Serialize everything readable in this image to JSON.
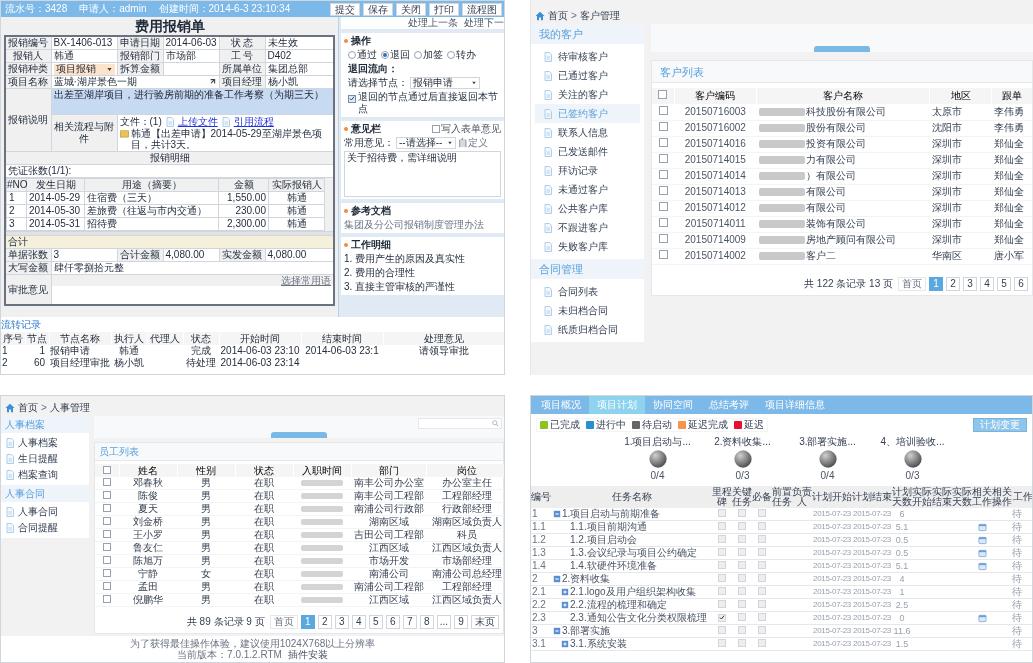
{
  "expense_form": {
    "header": [
      "流水号：3428",
      "申请人：admin",
      "创建时间：2014-6-3 23:10:34"
    ],
    "toolbar": [
      "提交",
      "保存",
      "关闭",
      "打印",
      "流程图"
    ],
    "nav_links": [
      "处理上一条",
      "处理下一"
    ],
    "title": "费用报销单",
    "field_rows": [
      [
        {
          "label": "报销编号",
          "value": "BX-1406-013"
        },
        {
          "label": "申请日期",
          "value": "2014-06-03"
        },
        {
          "label": "状 态",
          "value": "未生效"
        }
      ],
      [
        {
          "label": "报销人",
          "value": "韩通"
        },
        {
          "label": "报销部门",
          "value": "市场部"
        },
        {
          "label": "工 号",
          "value": "D402"
        }
      ],
      [
        {
          "label": "报销种类",
          "value": "项目报销",
          "kind": "select"
        },
        {
          "label": "拆算金额"
        },
        {
          "label": "所属单位",
          "value": "集团总部"
        }
      ],
      [
        {
          "label": "项目名称",
          "value": "蓝城·湖岸景色一期",
          "kind": "lookup"
        },
        {
          "label": "项目经理",
          "value": "杨小凯"
        }
      ]
    ],
    "description": {
      "label": "报销说明",
      "value": "出差至湖岸项目，进行验房前期的准备工作考察（为期三天）"
    },
    "related": {
      "label": "相关流程与附件",
      "files": "文件：(1)",
      "links": [
        "上传文件",
        "引用流程"
      ],
      "flow": "韩通【出差申请】2014-05-29至湖岸景色项目，共计3天。"
    },
    "details_title": "报销明细",
    "voucher": "凭证张数(1/1):",
    "details": {
      "columns": [
        "#NO",
        "发生日期",
        "用途（摘要）",
        "金额",
        "实际报销人"
      ],
      "rows": [
        [
          "1",
          "2014-05-29",
          "住宿费（三天）",
          "1,550.00",
          "韩通"
        ],
        [
          "2",
          "2014-05-30",
          "差旅费（往返与市内交通）",
          "230.00",
          "韩通"
        ],
        [
          "3",
          "2014-05-31",
          "招待费",
          "2,300.00",
          "韩通"
        ]
      ],
      "total_label": "合计"
    },
    "summary": [
      {
        "label": "单据张数",
        "value": "3"
      },
      {
        "label": "合计金额",
        "value": "4,080.00"
      },
      {
        "label": "实发金额",
        "value": "4,080.00"
      }
    ],
    "amount_words": {
      "label": "大写金额",
      "value": "肆仟零捌拾元整"
    },
    "approval": {
      "label": "审批意见",
      "link": "选择常用语"
    },
    "operation": {
      "title": "操作",
      "options": [
        {
          "label": "通过",
          "selected": false
        },
        {
          "label": "退回",
          "selected": true
        },
        {
          "label": "加签",
          "selected": false
        },
        {
          "label": "转办",
          "selected": false
        }
      ],
      "return_label": "退回流向：",
      "node_label": "请选择节点：",
      "node_value": "报销申请",
      "direct_return": {
        "label": "退回的节点通过后直接返回本节点",
        "checked": true
      }
    },
    "opinion": {
      "title": "意见栏",
      "write_form": {
        "label": "写入表单意见",
        "checked": false
      },
      "common_label": "常用意见：",
      "common_value": "--请选择--",
      "custom_link": "自定义",
      "text": "关于招待费，需详细说明"
    },
    "reference": {
      "title": "参考文档",
      "link": "集团及分公司报销制度管理办法"
    },
    "work_details": {
      "title": "工作明细",
      "items": [
        "1. 费用产生的原因及真实性",
        "2. 费用的合理性",
        "3. 直接主管审核的严谨性"
      ]
    },
    "history": {
      "title": "流转记录",
      "columns": [
        "序号",
        "节点",
        "节点名称",
        "执行人",
        "代理人",
        "状态",
        "开始时间",
        "结束时间",
        "处理意见"
      ],
      "rows": [
        [
          "1",
          "1",
          "报销申请",
          "韩通",
          "",
          "完成",
          "2014-06-03 23:10",
          "2014-06-03 23:1",
          "请领导审批"
        ],
        [
          "2",
          "60",
          "项目经理审批",
          "杨小凯",
          "",
          "待处理",
          "2014-06-03 23:14",
          "",
          ""
        ]
      ]
    }
  },
  "customer_page": {
    "breadcrumb": [
      "首页",
      "客户管理"
    ],
    "separator": ">",
    "sidebar": [
      {
        "heading": "我的客户",
        "items": [
          {
            "label": "待审核客户",
            "selected": false
          },
          {
            "label": "已通过客户",
            "selected": false
          },
          {
            "label": "关注的客户",
            "selected": false
          },
          {
            "label": "已签约客户",
            "selected": true
          },
          {
            "label": "联系人信息",
            "selected": false
          },
          {
            "label": "已发送邮件",
            "selected": false
          },
          {
            "label": "拜访记录",
            "selected": false
          },
          {
            "label": "未通过客户",
            "selected": false
          },
          {
            "label": "公共客户库",
            "selected": false
          },
          {
            "label": "不跟进客户",
            "selected": false
          },
          {
            "label": "失败客户库",
            "selected": false
          }
        ]
      },
      {
        "heading": "合同管理",
        "items": [
          {
            "label": "合同列表",
            "selected": false
          },
          {
            "label": "未归档合同",
            "selected": false
          },
          {
            "label": "纸质归档合同",
            "selected": false
          }
        ]
      }
    ],
    "list_title": "客户列表",
    "select_all": false,
    "columns": [
      "客户编码",
      "客户名称",
      "地区",
      "跟单"
    ],
    "rows": [
      {
        "checked": false,
        "code": "20150716003",
        "name": "科技股份有限公司",
        "region": "太原市",
        "owner": "李伟勇"
      },
      {
        "checked": false,
        "code": "20150716002",
        "name": "股份有限公司",
        "region": "沈阳市",
        "owner": "李伟勇"
      },
      {
        "checked": false,
        "code": "20150714016",
        "name": "投资有限公司",
        "region": "深圳市",
        "owner": "郑仙全"
      },
      {
        "checked": false,
        "code": "20150714015",
        "name": "力有限公司",
        "region": "深圳市",
        "owner": "郑仙全"
      },
      {
        "checked": false,
        "code": "20150714014",
        "name": "）有限公司",
        "region": "深圳市",
        "owner": "郑仙全"
      },
      {
        "checked": false,
        "code": "20150714013",
        "name": "有限公司",
        "region": "深圳市",
        "owner": "郑仙全"
      },
      {
        "checked": false,
        "code": "20150714012",
        "name": "有限公司",
        "region": "深圳市",
        "owner": "郑仙全"
      },
      {
        "checked": false,
        "code": "20150714011",
        "name": "装饰有限公司",
        "region": "深圳市",
        "owner": "郑仙全"
      },
      {
        "checked": false,
        "code": "20150714009",
        "name": "房地产顾问有限公司",
        "region": "深圳市",
        "owner": "郑仙全"
      },
      {
        "checked": false,
        "code": "20150714002",
        "name": "客户二",
        "region": "华南区",
        "owner": "唐小军"
      }
    ],
    "pagination": {
      "summary": "共 122 条记录 13 页",
      "first": "首页",
      "pages": [
        {
          "label": "1",
          "selected": true
        },
        {
          "label": "2",
          "selected": false
        },
        {
          "label": "3",
          "selected": false
        },
        {
          "label": "4",
          "selected": false
        },
        {
          "label": "5",
          "selected": false
        },
        {
          "label": "6",
          "selected": false
        }
      ]
    }
  },
  "hr_page": {
    "breadcrumb": [
      "首页",
      "人事管理"
    ],
    "separator": ">",
    "sidebar": [
      {
        "heading": "人事档案",
        "items": [
          "人事档案",
          "生日提醒",
          "档案查询"
        ]
      },
      {
        "heading": "人事合同",
        "items": [
          "人事合同",
          "合同提醒"
        ]
      }
    ],
    "list_title": "员工列表",
    "select_all": false,
    "columns": [
      "姓名",
      "性别",
      "状态",
      "入职时间",
      "部门",
      "岗位"
    ],
    "rows": [
      {
        "checked": false,
        "name": "邓春秋",
        "gender": "男",
        "status": "在职",
        "dept": "南丰公司办公室",
        "post": "办公室主任"
      },
      {
        "checked": false,
        "name": "陈俊",
        "gender": "男",
        "status": "在职",
        "dept": "南丰公司工程部",
        "post": "工程部经理"
      },
      {
        "checked": false,
        "name": "夏天",
        "gender": "男",
        "status": "在职",
        "dept": "南浦公司行政部",
        "post": "行政部经理"
      },
      {
        "checked": false,
        "name": "刘金桥",
        "gender": "男",
        "status": "在职",
        "dept": "湖南区域",
        "post": "湖南区域负责人"
      },
      {
        "checked": false,
        "name": "王小罗",
        "gender": "男",
        "status": "在职",
        "dept": "吉田公司工程部",
        "post": "科员"
      },
      {
        "checked": false,
        "name": "鲁友仁",
        "gender": "男",
        "status": "在职",
        "dept": "江西区域",
        "post": "江西区域负责人"
      },
      {
        "checked": false,
        "name": "陈旭万",
        "gender": "男",
        "status": "在职",
        "dept": "市场开发",
        "post": "市场部经理"
      },
      {
        "checked": false,
        "name": "宁静",
        "gender": "女",
        "status": "在职",
        "dept": "南浦公司",
        "post": "南浦公司总经理"
      },
      {
        "checked": false,
        "name": "孟田",
        "gender": "男",
        "status": "在职",
        "dept": "南浦公司工程部",
        "post": "工程部经理"
      },
      {
        "checked": false,
        "name": "倪鹏华",
        "gender": "男",
        "status": "在职",
        "dept": "江西区域",
        "post": "江西区域负责人"
      }
    ],
    "pagination": {
      "summary": "共 89 条记录 9 页",
      "first": "首页",
      "pages": [
        {
          "label": "1",
          "selected": true
        },
        {
          "label": "2",
          "selected": false
        },
        {
          "label": "3",
          "selected": false
        },
        {
          "label": "4",
          "selected": false
        },
        {
          "label": "5",
          "selected": false
        },
        {
          "label": "6",
          "selected": false
        },
        {
          "label": "7",
          "selected": false
        },
        {
          "label": "8",
          "selected": false
        },
        {
          "label": "...",
          "selected": false
        },
        {
          "label": "9",
          "selected": false
        }
      ],
      "last": "末页"
    },
    "footer": [
      "为了获得最佳操作体验，建议使用1024X768以上分辨率",
      "当前版本：7.0.1.2.RTM",
      "插件安装"
    ]
  },
  "project_plan": {
    "tabs": [
      {
        "label": "项目概况",
        "selected": false
      },
      {
        "label": "项目计划",
        "selected": true
      },
      {
        "label": "协同空间",
        "selected": false
      },
      {
        "label": "总结考评",
        "selected": false
      },
      {
        "label": "项目详细信息",
        "selected": false
      }
    ],
    "legend": [
      {
        "label": "已完成",
        "color": "#8dc21f"
      },
      {
        "label": "进行中",
        "color": "#2a8fcf"
      },
      {
        "label": "待启动",
        "color": "#666666"
      },
      {
        "label": "延迟完成",
        "color": "#f7934c"
      },
      {
        "label": "延迟",
        "color": "#e8112d"
      }
    ],
    "change_button": "计划变更",
    "milestones": [
      {
        "label": "1.项目启动与...",
        "count": "0/4"
      },
      {
        "label": "2.资料收集...",
        "count": "0/3"
      },
      {
        "label": "3.部署实施...",
        "count": "0/4"
      },
      {
        "label": "4、培训验收...",
        "count": "0/3"
      }
    ],
    "columns": [
      "编号",
      "任务名称",
      "里程碑",
      "关键任务",
      "必备",
      "前置任务",
      "负责人",
      "计划开始",
      "计划结束",
      "计划天数",
      "实际开始",
      "实际结束",
      "实际天数",
      "相关工作",
      "相关操作",
      "工作"
    ],
    "tasks": [
      {
        "no": "1",
        "name": "1.项目启动与前期准备",
        "expanded": true,
        "milestone": false,
        "key_task": false,
        "required": false,
        "start": "2015-07-23",
        "end": "2015-07-23",
        "days": "6",
        "work": false,
        "status": "待",
        "children": [
          {
            "no": "1.1",
            "name": "1.1.项目前期沟通",
            "milestone": false,
            "key_task": false,
            "required": false,
            "start": "2015-07-23",
            "end": "2015-07-23",
            "days": "5.1",
            "work": true,
            "status": "待"
          },
          {
            "no": "1.2",
            "name": "1.2.项目启动会",
            "milestone": false,
            "key_task": false,
            "required": false,
            "start": "2015-07-23",
            "end": "2015-07-23",
            "days": "0.5",
            "work": true,
            "status": "待"
          },
          {
            "no": "1.3",
            "name": "1.3.会议纪录与项目公约确定",
            "milestone": false,
            "key_task": false,
            "required": false,
            "start": "2015-07-23",
            "end": "2015-07-23",
            "days": "0.5",
            "work": true,
            "status": "待"
          },
          {
            "no": "1.4",
            "name": "1.4.软硬件环境准备",
            "milestone": false,
            "key_task": false,
            "required": false,
            "start": "2015-07-23",
            "end": "2015-07-23",
            "days": "5.1",
            "work": true,
            "status": "待"
          }
        ]
      },
      {
        "no": "2",
        "name": "2.资料收集",
        "expanded": true,
        "milestone": false,
        "key_task": false,
        "required": false,
        "start": "2015-07-23",
        "end": "2015-07-23",
        "days": "4",
        "work": false,
        "status": "待",
        "children": [
          {
            "no": "2.1",
            "name": "2.1.logo及用户组织架构收集",
            "expanded": false,
            "milestone": false,
            "key_task": false,
            "required": false,
            "start": "2015-07-23",
            "end": "2015-07-23",
            "days": "1",
            "work": false,
            "status": "待"
          },
          {
            "no": "2.2",
            "name": "2.2.流程的梳理和确定",
            "expanded": false,
            "milestone": false,
            "key_task": false,
            "required": false,
            "start": "2015-07-23",
            "end": "2015-07-23",
            "days": "2.5",
            "work": false,
            "status": "待"
          },
          {
            "no": "2.3",
            "name": "2.3.通知公告文化分类权限梳理",
            "milestone": true,
            "key_task": false,
            "required": false,
            "start": "2015-07-23",
            "end": "2015-07-23",
            "days": "0",
            "work": true,
            "status": "待"
          }
        ]
      },
      {
        "no": "3",
        "name": "3.部署实施",
        "expanded": true,
        "milestone": false,
        "key_task": false,
        "required": false,
        "start": "2015-07-23",
        "end": "2015-07-23",
        "days": "11.6",
        "work": false,
        "status": "待",
        "children": [
          {
            "no": "3.1",
            "name": "3.1.系统安装",
            "expanded": false,
            "milestone": false,
            "key_task": false,
            "required": false,
            "start": "2015-07-23",
            "end": "2015-07-23",
            "days": "1.5",
            "work": false,
            "status": "待"
          }
        ]
      }
    ]
  }
}
